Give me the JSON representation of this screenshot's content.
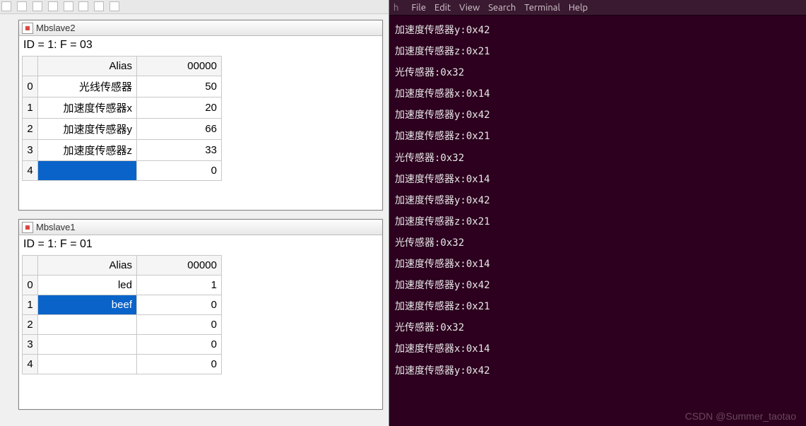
{
  "left": {
    "win_a": {
      "title": "Mbslave2",
      "sub": "ID = 1: F = 03",
      "headers": {
        "alias": "Alias",
        "val": "00000"
      },
      "rows": [
        {
          "idx": "0",
          "alias": "光线传感器",
          "val": "50"
        },
        {
          "idx": "1",
          "alias": "加速度传感器x",
          "val": "20"
        },
        {
          "idx": "2",
          "alias": "加速度传感器y",
          "val": "66"
        },
        {
          "idx": "3",
          "alias": "加速度传感器z",
          "val": "33"
        },
        {
          "idx": "4",
          "alias": "",
          "val": "0"
        }
      ],
      "selected_row": 4
    },
    "win_b": {
      "title": "Mbslave1",
      "sub": "ID = 1: F = 01",
      "headers": {
        "alias": "Alias",
        "val": "00000"
      },
      "rows": [
        {
          "idx": "0",
          "alias": "led",
          "val": "1"
        },
        {
          "idx": "1",
          "alias": "beef",
          "val": "0"
        },
        {
          "idx": "2",
          "alias": "",
          "val": "0"
        },
        {
          "idx": "3",
          "alias": "",
          "val": "0"
        },
        {
          "idx": "4",
          "alias": "",
          "val": "0"
        }
      ],
      "selected_row": 1
    }
  },
  "right": {
    "menu": [
      "File",
      "Edit",
      "View",
      "Search",
      "Terminal",
      "Help"
    ],
    "title_hint": "h",
    "lines": [
      "加速度传感器y:0x42",
      "加速度传感器z:0x21",
      "光传感器:0x32",
      "加速度传感器x:0x14",
      "加速度传感器y:0x42",
      "加速度传感器z:0x21",
      "光传感器:0x32",
      "加速度传感器x:0x14",
      "加速度传感器y:0x42",
      "加速度传感器z:0x21",
      "光传感器:0x32",
      "加速度传感器x:0x14",
      "加速度传感器y:0x42",
      "加速度传感器z:0x21",
      "光传感器:0x32",
      "加速度传感器x:0x14",
      "加速度传感器y:0x42"
    ],
    "watermark": "CSDN @Summer_taotao"
  }
}
